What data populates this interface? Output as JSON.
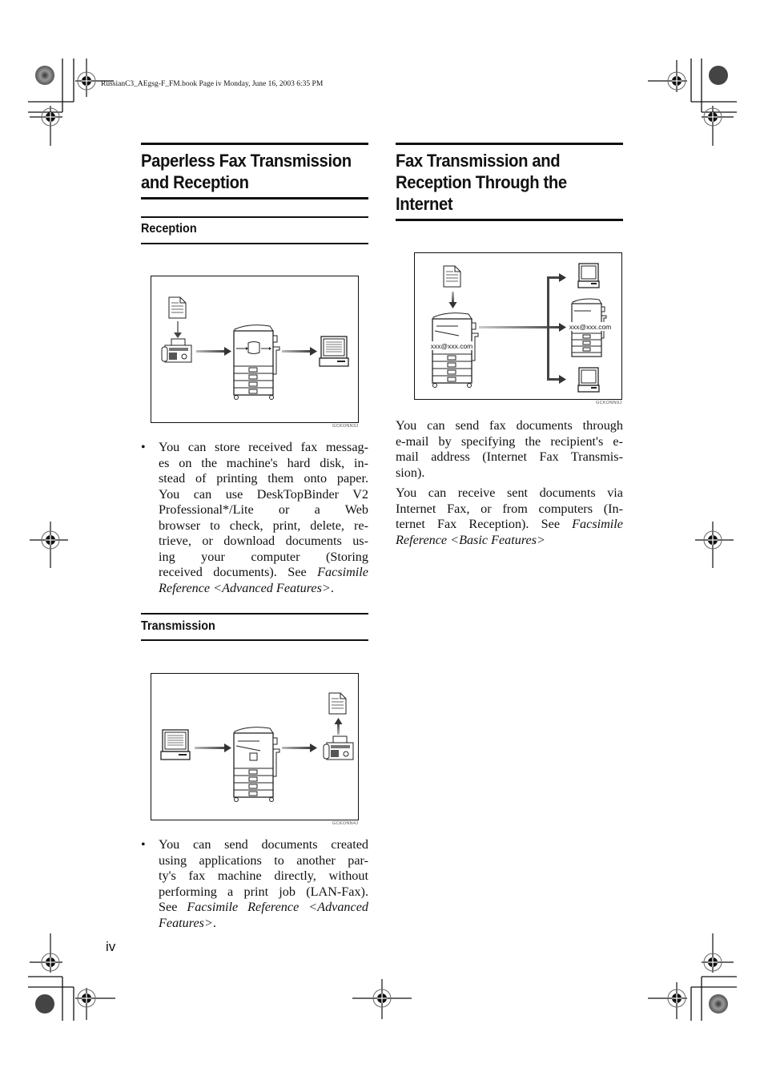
{
  "header": {
    "file_info": "RussianC3_AEgsg-F_FM.book  Page iv  Monday, June 16, 2003  6:35 PM"
  },
  "left_column": {
    "section_title_line1": "Paperless Fax Transmission",
    "section_title_line2": "and Reception",
    "reception": {
      "heading": "Reception",
      "figure_code": "GCKONN3J",
      "figure_icons": [
        "document-icon",
        "fax-machine-icon",
        "copier-hdd-icon",
        "computer-icon"
      ],
      "bullet": {
        "lines": [
          "You can store received fax messag-",
          "es on the machine's hard disk, in-",
          "stead of printing them onto paper.",
          "You can use DeskTopBinder V2",
          "Professional*/Lite or a Web",
          "browser to check, print, delete, re-",
          "trieve, or download documents us-",
          "ing your computer (Storing"
        ],
        "line9_plain": "received documents). See ",
        "line9_italic": "Facsimile",
        "line10_italic": "Reference <Advanced Features>",
        "line10_end": "."
      }
    },
    "transmission": {
      "heading": "Transmission",
      "figure_code": "GCKONN4J",
      "figure_icons": [
        "computer-icon",
        "copier-icon",
        "fax-machine-icon",
        "document-icon"
      ],
      "bullet": {
        "lines": [
          "You can send documents created",
          "using applications to another par-",
          "ty's fax machine directly, without",
          "performing a print job (LAN-Fax)."
        ],
        "line5_plain": "See ",
        "line5_italic": "Facsimile Reference <Advanced",
        "line6_italic": "Features>",
        "line6_end": "."
      }
    }
  },
  "right_column": {
    "section_title_line1": "Fax Transmission and",
    "section_title_line2": "Reception Through the",
    "section_title_line3": "Internet",
    "figure_code": "GCKONN9J",
    "email_label_sender": "xxx@xxx.com",
    "email_label_receiver": "xxx@xxx.com",
    "paragraph1_lines": [
      "You can send fax documents through",
      "e-mail by specifying the recipient's e-",
      "mail address (Internet Fax Transmis-",
      "sion)."
    ],
    "paragraph2_lines": [
      "You can receive sent documents via",
      "Internet Fax, or from computers (In-"
    ],
    "paragraph2_line3_plain": "ternet Fax Reception). See ",
    "paragraph2_line3_italic": "Facsimile",
    "paragraph2_line4_italic": "Reference <Basic Features>"
  },
  "footer": {
    "page_number": "iv"
  }
}
